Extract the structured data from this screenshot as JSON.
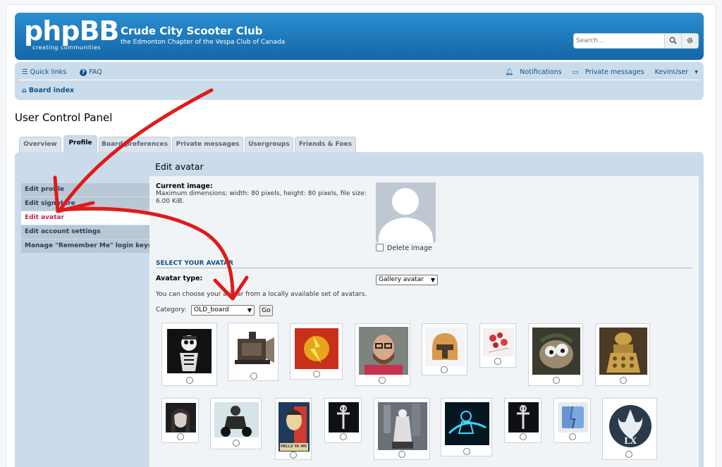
{
  "header": {
    "logo_text": "phpBB",
    "logo_reg": "®",
    "logo_sub": "creating communities",
    "site_title": "Crude City Scooter Club",
    "site_desc": "the Edmonton Chapter of the Vespa Club of Canada",
    "search_placeholder": "Search…"
  },
  "nav": {
    "quick_links": "Quick links",
    "faq": "FAQ",
    "notifications": "Notifications",
    "private_messages": "Private messages",
    "user": "KevinUser",
    "board_index": "Board index"
  },
  "page_title": "User Control Panel",
  "tabs": [
    "Overview",
    "Profile",
    "Board preferences",
    "Private messages",
    "Usergroups",
    "Friends & Foes"
  ],
  "sidebar": [
    "Edit profile",
    "Edit signature",
    "Edit avatar",
    "Edit account settings",
    "Manage \"Remember Me\" login keys"
  ],
  "avatar": {
    "title": "Edit avatar",
    "current_label": "Current image:",
    "current_desc": "Maximum dimensions; width: 80 pixels, height: 80 pixels, file size: 6.00 KiB.",
    "delete_label": "Delete image",
    "section_title": "SELECT YOUR AVATAR",
    "type_label": "Avatar type:",
    "type_value": "Gallery avatar",
    "choose_text": "You can choose your avatar from a locally available set of avatars.",
    "category_label": "Category:",
    "category_value": "OLD_board",
    "go_label": "Go"
  },
  "gallery_icons": [
    "skeleton-smoking-icon",
    "vintage-camera-icon",
    "flash-hero-icon",
    "bearded-man-glasses-icon",
    "clone-trooper-icon",
    "red-flowers-icon",
    "creature-character-icon",
    "dalek-icon",
    "woman-portrait-icon",
    "scooter-rider-icon",
    "hell-ya-we-can-poster-icon",
    "cross-emblem-icon",
    "robot-soldier-icon",
    "tron-rider-icon",
    "cross-emblem-icon-2",
    "mac-finder-icon",
    "lx-rebel-emblem-icon"
  ],
  "gallery_poster_caption": "HELLZ YA WE CAN",
  "gallery_emblem_caption": "LX",
  "colors": {
    "header_blue": "#1a72b3",
    "nav_bg": "#cadceb",
    "active_link": "#bc2a4d",
    "annotation_red": "#e01a1a"
  }
}
